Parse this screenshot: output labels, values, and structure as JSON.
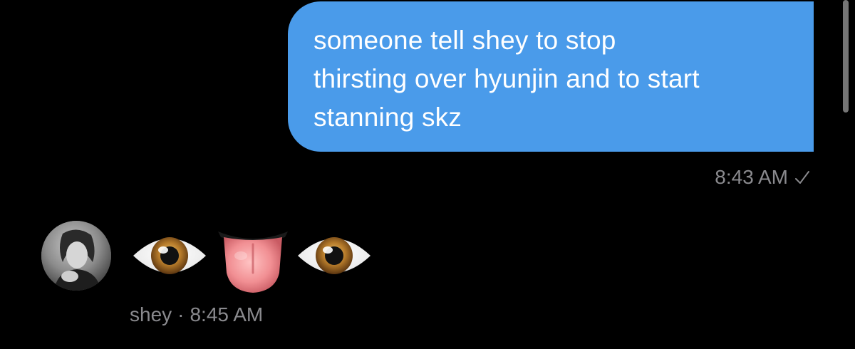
{
  "conversation": {
    "outgoing": {
      "text": "someone tell shey to stop\nthirsting over hyunjin and to start\nstanning skz",
      "time": "8:43 AM",
      "status_icon": "check-icon"
    },
    "incoming": {
      "sender": "shey",
      "separator": "·",
      "time": "8:45 AM",
      "emojis": [
        "eye-icon",
        "tongue-icon",
        "eye-icon"
      ],
      "avatar_icon": "avatar"
    }
  },
  "colors": {
    "background": "#000000",
    "outgoing_bubble": "#4a9bea",
    "meta_text": "#8a8a8e"
  }
}
